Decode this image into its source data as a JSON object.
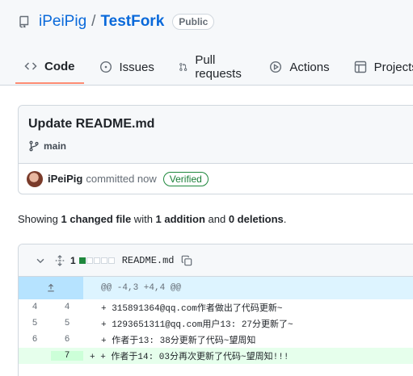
{
  "repo": {
    "owner": "iPeiPig",
    "separator": "/",
    "name": "TestFork",
    "visibility": "Public"
  },
  "tabs": [
    {
      "label": "Code",
      "icon": "code-icon",
      "selected": true
    },
    {
      "label": "Issues",
      "icon": "issue-icon"
    },
    {
      "label": "Pull requests",
      "icon": "pull-request-icon"
    },
    {
      "label": "Actions",
      "icon": "play-icon"
    },
    {
      "label": "Projects",
      "icon": "table-icon"
    }
  ],
  "commit": {
    "title": "Update README.md",
    "branch": "main",
    "author": "iPeiPig",
    "action_text": "committed now",
    "verified_label": "Verified"
  },
  "summary": {
    "prefix": "Showing ",
    "changed": "1 changed file",
    "with": " with ",
    "additions": "1 addition",
    "and": " and ",
    "deletions": "0 deletions",
    "suffix": "."
  },
  "diff": {
    "count": "1",
    "filename": "README.md",
    "hunk_header": "@@ -4,3 +4,4 @@",
    "lines": [
      {
        "old": "4",
        "new": "4",
        "text": "+ 315891364@qq.com作者做出了代码更新~",
        "added": false
      },
      {
        "old": "5",
        "new": "5",
        "text": "+ 1293651311@qq.com用户13: 27分更新了~",
        "added": false
      },
      {
        "old": "6",
        "new": "6",
        "text": "+ 作者于13: 38分更新了代码~望周知",
        "added": false
      },
      {
        "old": "",
        "new": "7",
        "text": "+ + 作者于14: 03分再次更新了代码~望周知!!!",
        "added": true
      }
    ]
  },
  "colors": {
    "link": "#0969da",
    "tab_underline": "#fd8c73",
    "verified": "#1a7f37",
    "addition_bg": "#e6ffec",
    "hunk_bg": "#ddf4ff"
  }
}
